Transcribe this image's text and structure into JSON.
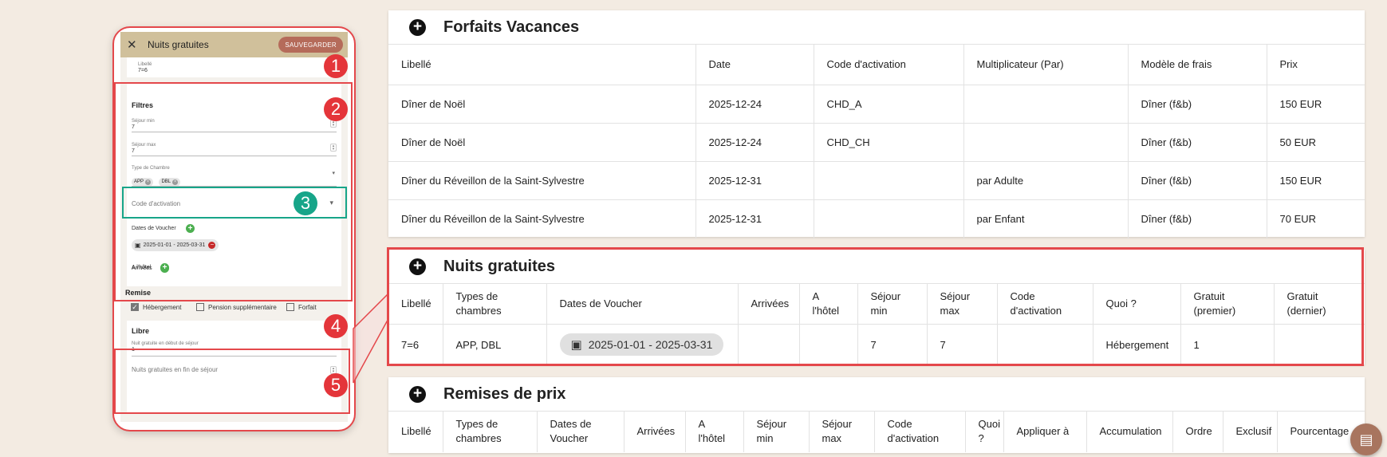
{
  "editor": {
    "header_title": "Nuits gratuites",
    "save_label": "SAUVEGARDER",
    "libelle_label": "Libellé",
    "libelle_value": "7=6",
    "filters_title": "Filtres",
    "sejour_min_label": "Séjour min",
    "sejour_min_value": "7",
    "sejour_max_label": "Séjour max",
    "sejour_max_value": "7",
    "room_type_label": "Type de Chambre",
    "room_chips": [
      "APP",
      "DBL"
    ],
    "activation_code_placeholder": "Code d'activation",
    "voucher_dates_label": "Dates de Voucher",
    "voucher_date_range": "2025-01-01 - 2025-03-31",
    "arrivals_label": "Arrivées",
    "hotel_label": "A l'hôtel",
    "remise_title": "Remise",
    "remise_options": [
      {
        "label": "Hébergement",
        "checked": true
      },
      {
        "label": "Pension supplémentaire",
        "checked": false
      },
      {
        "label": "Forfait",
        "checked": false
      }
    ],
    "libre_title": "Libre",
    "free_start_label": "Nuit gratuite en début de séjour",
    "free_start_value": "1",
    "free_end_placeholder": "Nuits gratuites en fin de séjour"
  },
  "badges": [
    "1",
    "2",
    "3",
    "4",
    "5"
  ],
  "forfaits": {
    "title": "Forfaits Vacances",
    "columns": [
      "Libellé",
      "Date",
      "Code d'activation",
      "Multiplicateur (Par)",
      "Modèle de frais",
      "Prix"
    ],
    "rows": [
      [
        "Dîner de Noël",
        "2025-12-24",
        "CHD_A",
        "",
        "Dîner (f&b)",
        "150 EUR"
      ],
      [
        "Dîner de Noël",
        "2025-12-24",
        "CHD_CH",
        "",
        "Dîner (f&b)",
        "50 EUR"
      ],
      [
        "Dîner du Réveillon de la Saint-Sylvestre",
        "2025-12-31",
        "",
        "par Adulte",
        "Dîner (f&b)",
        "150 EUR"
      ],
      [
        "Dîner du Réveillon de la Saint-Sylvestre",
        "2025-12-31",
        "",
        "par Enfant",
        "Dîner (f&b)",
        "70 EUR"
      ]
    ]
  },
  "nuits": {
    "title": "Nuits gratuites",
    "columns": [
      "Libellé",
      "Types de chambres",
      "Dates de Voucher",
      "Arrivées",
      "A l'hôtel",
      "Séjour min",
      "Séjour max",
      "Code d'activation",
      "Quoi ?",
      "Gratuit (premier)",
      "Gratuit (dernier)"
    ],
    "row": {
      "libelle": "7=6",
      "types": "APP, DBL",
      "dates": "2025-01-01 - 2025-03-31",
      "arrivees": "",
      "hotel": "",
      "sejour_min": "7",
      "sejour_max": "7",
      "code": "",
      "quoi": "Hébergement",
      "gratuit_premier": "1",
      "gratuit_dernier": ""
    }
  },
  "remises": {
    "title": "Remises de prix",
    "columns": [
      "Libellé",
      "Types de chambres",
      "Dates de Voucher",
      "Arrivées",
      "A l'hôtel",
      "Séjour min",
      "Séjour max",
      "Code d'activation",
      "Quoi ?",
      "Appliquer à",
      "Accumulation",
      "Ordre",
      "Exclusif",
      "Pourcentage"
    ]
  },
  "colors": {
    "accent_red": "#e4484b",
    "teal": "#17a589",
    "header_tan": "#d0c09b",
    "save_btn": "#b56b5a"
  }
}
